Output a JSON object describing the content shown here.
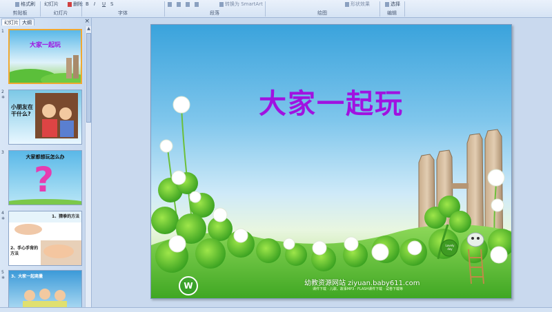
{
  "ribbon": {
    "buttons": {
      "format_painter": "格式刷",
      "new_slide": "幻灯片",
      "delete": "删除",
      "convert_smartart": "转换为 SmartArt",
      "shape_effects": "形状效果",
      "select": "选择"
    },
    "groups": [
      "剪贴板",
      "幻灯片",
      "字体",
      "段落",
      "绘图",
      "编辑"
    ]
  },
  "panel": {
    "tabs": [
      "幻灯片",
      "大纲"
    ],
    "close": "×",
    "slides": [
      {
        "num": "1",
        "title": "大家一起玩"
      },
      {
        "num": "2",
        "title": "小朋友在干什么?"
      },
      {
        "num": "3",
        "title": "大家都想玩怎么办"
      },
      {
        "num": "4",
        "text_a": "1、猜拳的方法",
        "text_b": "2、手心手背的方法"
      },
      {
        "num": "5",
        "title": "3、大家一起商量"
      }
    ]
  },
  "slide": {
    "title": "大家一起玩",
    "footer": "幼教资源网站  ziyuan.baby611.com",
    "footer_sub": "课件下载 · 儿歌、故事MP3 · FLASH课件下载 · 试卷下载等",
    "sign": "Lovely day"
  },
  "colors": {
    "title": "#a012e0",
    "active_thumb_border": "#f0a830",
    "ribbon_bg": "#d5e3f4"
  }
}
